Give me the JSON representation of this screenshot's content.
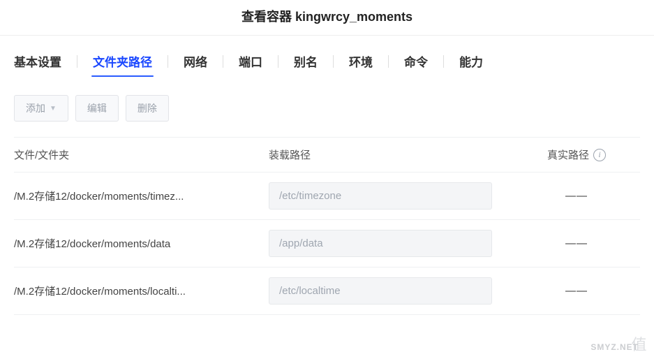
{
  "header": {
    "title": "查看容器 kingwrcy_moments"
  },
  "tabs": {
    "items": [
      {
        "label": "基本设置"
      },
      {
        "label": "文件夹路径"
      },
      {
        "label": "网络"
      },
      {
        "label": "端口"
      },
      {
        "label": "别名"
      },
      {
        "label": "环境"
      },
      {
        "label": "命令"
      },
      {
        "label": "能力"
      }
    ],
    "activeIndex": 1
  },
  "toolbar": {
    "add_label": "添加",
    "edit_label": "编辑",
    "delete_label": "删除"
  },
  "table": {
    "headers": {
      "file": "文件/文件夹",
      "mount": "装载路径",
      "real": "真实路径"
    },
    "rows": [
      {
        "file": "/M.2存储12/docker/moments/timez...",
        "mount": "/etc/timezone",
        "real": "——"
      },
      {
        "file": "/M.2存储12/docker/moments/data",
        "mount": "/app/data",
        "real": "——"
      },
      {
        "file": "/M.2存储12/docker/moments/localti...",
        "mount": "/etc/localtime",
        "real": "——"
      }
    ]
  },
  "watermark": {
    "text1": "值",
    "text2": "SMYZ.NET"
  }
}
